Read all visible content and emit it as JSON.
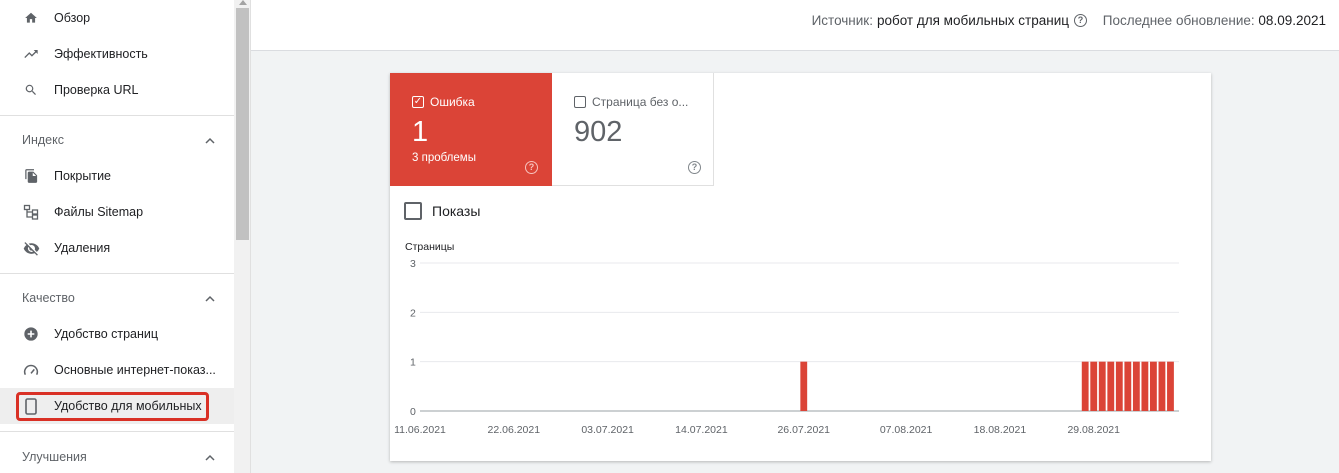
{
  "sidebar": {
    "top_items": [
      {
        "label": "Обзор",
        "icon": "home-icon"
      },
      {
        "label": "Эффективность",
        "icon": "trending-up-icon"
      },
      {
        "label": "Проверка URL",
        "icon": "search-icon"
      }
    ],
    "sections": [
      {
        "title": "Индекс",
        "items": [
          {
            "label": "Покрытие",
            "icon": "file-copy-icon"
          },
          {
            "label": "Файлы Sitemap",
            "icon": "sitemap-icon"
          },
          {
            "label": "Удаления",
            "icon": "visibility-off-icon"
          }
        ]
      },
      {
        "title": "Качество",
        "items": [
          {
            "label": "Удобство страниц",
            "icon": "add-circle-icon"
          },
          {
            "label": "Основные интернет-показ...",
            "icon": "speed-icon"
          },
          {
            "label": "Удобство для мобильных",
            "icon": "smartphone-icon"
          }
        ]
      },
      {
        "title": "Улучшения",
        "items": []
      }
    ]
  },
  "topbar": {
    "source_label": "Источник:",
    "source_value": "робот для мобильных страниц",
    "updated_label": "Последнее обновление:",
    "updated_value": "08.09.2021"
  },
  "tiles": {
    "error": {
      "label": "Ошибка",
      "count": "1",
      "sub": "3 проблемы",
      "checked": true,
      "color": "#db4437"
    },
    "ok": {
      "label": "Страница без о...",
      "count": "902",
      "checked": false
    }
  },
  "impressions_label": "Показы",
  "chart_data": {
    "type": "bar",
    "ylabel": "Страницы",
    "ylim": [
      0,
      3
    ],
    "yticks": [
      "0",
      "1",
      "2",
      "3"
    ],
    "xtick_labels": [
      "11.06.2021",
      "22.06.2021",
      "03.07.2021",
      "14.07.2021",
      "26.07.2021",
      "07.08.2021",
      "18.08.2021",
      "29.08.2021"
    ],
    "x_start": "2021-06-11",
    "x_end": "2021-09-08",
    "values_nonzero": [
      {
        "date": "2021-07-26",
        "value": 1
      },
      {
        "date": "2021-08-28",
        "value": 1
      },
      {
        "date": "2021-08-29",
        "value": 1
      },
      {
        "date": "2021-08-30",
        "value": 1
      },
      {
        "date": "2021-08-31",
        "value": 1
      },
      {
        "date": "2021-09-01",
        "value": 1
      },
      {
        "date": "2021-09-02",
        "value": 1
      },
      {
        "date": "2021-09-03",
        "value": 1
      },
      {
        "date": "2021-09-04",
        "value": 1
      },
      {
        "date": "2021-09-05",
        "value": 1
      },
      {
        "date": "2021-09-06",
        "value": 1
      },
      {
        "date": "2021-09-07",
        "value": 1
      }
    ],
    "bar_color": "#db4437"
  }
}
